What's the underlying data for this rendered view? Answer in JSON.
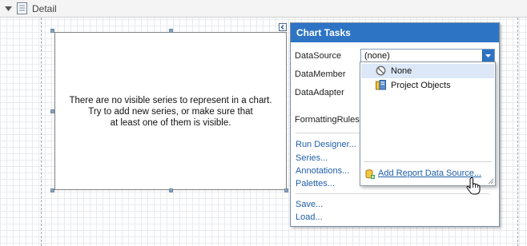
{
  "band": {
    "title": "Detail",
    "expand_icon": "triangle-down-icon",
    "band_icon": "report-band-icon"
  },
  "chart": {
    "message_lines": [
      "There are no visible series to represent in a chart.",
      "Try to add new series, or make sure that",
      "at least one of them is visible."
    ]
  },
  "tasks": {
    "title": "Chart Tasks",
    "smart_tag_icon": "collapse-arrow-icon",
    "properties": {
      "datasource": "DataSource",
      "datamember": "DataMember",
      "dataadapter": "DataAdapter",
      "formattingrules": "FormattingRules"
    },
    "datasource_value": "(none)",
    "actions": [
      "Run Designer...",
      "Series...",
      "Annotations...",
      "Palettes..."
    ],
    "file_actions": [
      "Save...",
      "Load..."
    ]
  },
  "dropdown": {
    "items": [
      {
        "label": "None",
        "icon": "none-circle-icon",
        "selected": true
      },
      {
        "label": "Project Objects",
        "icon": "project-objects-icon",
        "selected": false
      }
    ],
    "add_link": "Add Report Data Source...",
    "add_icon": "database-add-icon"
  },
  "colors": {
    "accent": "#2e74c4",
    "link": "#1f5fa8",
    "selection": "#dce8f7"
  }
}
